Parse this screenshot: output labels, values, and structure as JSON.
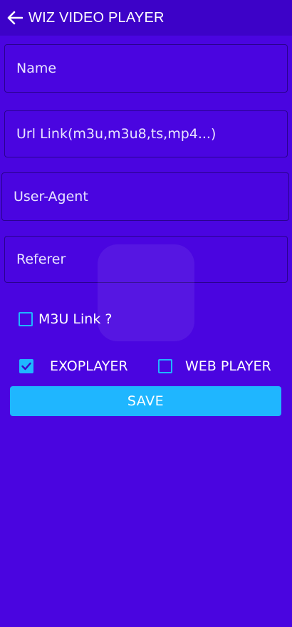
{
  "appbar": {
    "title": "WIZ VIDEO PLAYER",
    "back_icon": "arrow-left-icon"
  },
  "form": {
    "name_placeholder": "Name",
    "url_placeholder": "Url Link(m3u,m3u8,ts,mp4...)",
    "useragent_placeholder": "User-Agent",
    "referer_placeholder": "Referer"
  },
  "options": {
    "m3u_label": "M3U Link ?",
    "m3u_checked": false,
    "exoplayer_label": "EXOPLAYER",
    "exoplayer_checked": true,
    "webplayer_label": "WEB PLAYER",
    "webplayer_checked": false
  },
  "actions": {
    "save_label": "SAVE"
  },
  "colors": {
    "background": "#4a05e0",
    "appbar": "#3d02c8",
    "accent": "#1fb6ff"
  }
}
